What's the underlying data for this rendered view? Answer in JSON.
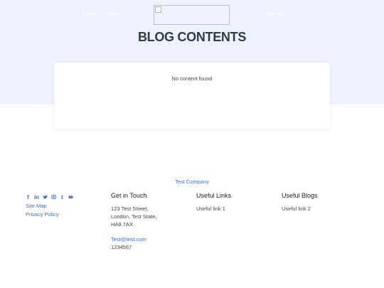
{
  "nav": {
    "home": "Home",
    "blog": "Blog",
    "signin": "Sign In"
  },
  "page": {
    "title": "BLOG CONTENTS",
    "empty_message": "No content found"
  },
  "footer": {
    "company": "Test Company",
    "social_icons": [
      "facebook-icon",
      "linkedin-icon",
      "twitter-icon",
      "instagram-icon",
      "tumblr-icon",
      "youtube-icon"
    ],
    "links": {
      "site_map": "Site Map",
      "privacy_policy": "Privacy Policy"
    },
    "get_in_touch": {
      "heading": "Get in Touch",
      "address_lines": [
        "123 Test Street,",
        "London, Test State,",
        "HA8 7AX"
      ],
      "email": "Test@test.com",
      "phone": "1234567"
    },
    "useful_links": {
      "heading": "Useful Links",
      "items": [
        "Useful link 1"
      ]
    },
    "useful_blogs": {
      "heading": "Useful Blogs",
      "items": [
        "Useful link 2"
      ]
    }
  },
  "colors": {
    "hero_bg": "#eef2fc",
    "accent": "#3d6fc4",
    "title": "#2f3a4a"
  }
}
